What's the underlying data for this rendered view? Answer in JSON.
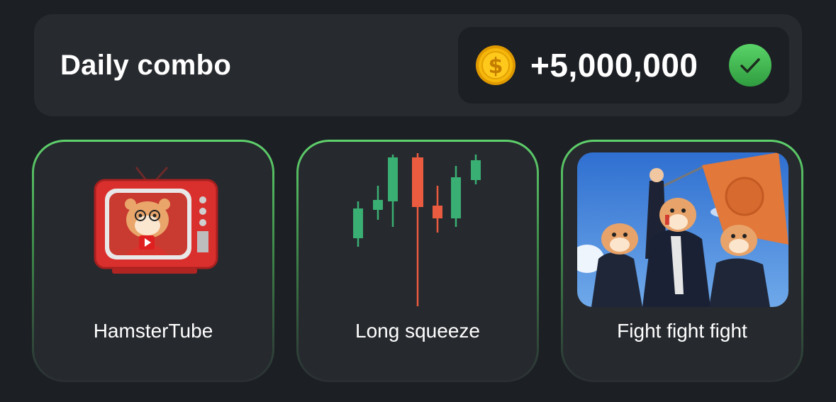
{
  "daily_combo": {
    "title": "Daily combo",
    "reward": "+5,000,000",
    "coin_icon": "dollar-coin-icon",
    "status_icon": "checkmark-icon",
    "colors": {
      "coin": "#f5b800",
      "check": "#3fb54f",
      "card_border": "#5fd26c"
    }
  },
  "cards": [
    {
      "label": "HamsterTube",
      "image": "hamster-tv-image"
    },
    {
      "label": "Long squeeze",
      "image": "candlestick-chart-image"
    },
    {
      "label": "Fight fight fight",
      "image": "hamsters-in-suits-with-flag-image"
    }
  ]
}
